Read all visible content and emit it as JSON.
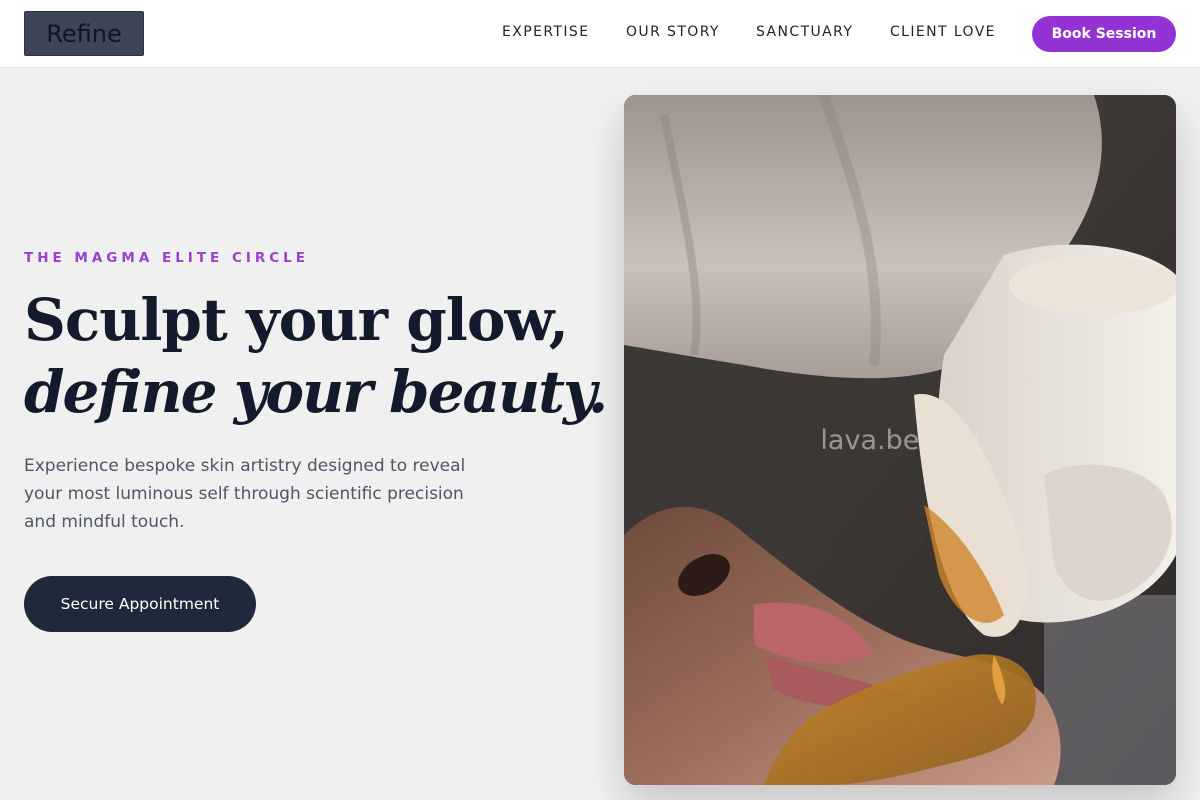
{
  "header": {
    "logo": "Refine",
    "nav": [
      "EXPERTISE",
      "OUR STORY",
      "SANCTUARY",
      "CLIENT LOVE"
    ],
    "book_label": "Book Session"
  },
  "hero": {
    "eyebrow": "THE MAGMA ELITE CIRCLE",
    "headline_line1": "Sculpt your glow,",
    "headline_line2": "define your beauty.",
    "lede": "Experience bespoke skin artistry designed to reveal your most luminous self through scientific precision and mindful touch.",
    "cta_label": "Secure Appointment"
  },
  "image": {
    "watermark": "lava.beauty"
  },
  "colors": {
    "accent": "#9333d4",
    "navy": "#1e293b",
    "background": "#f0f0f0"
  }
}
